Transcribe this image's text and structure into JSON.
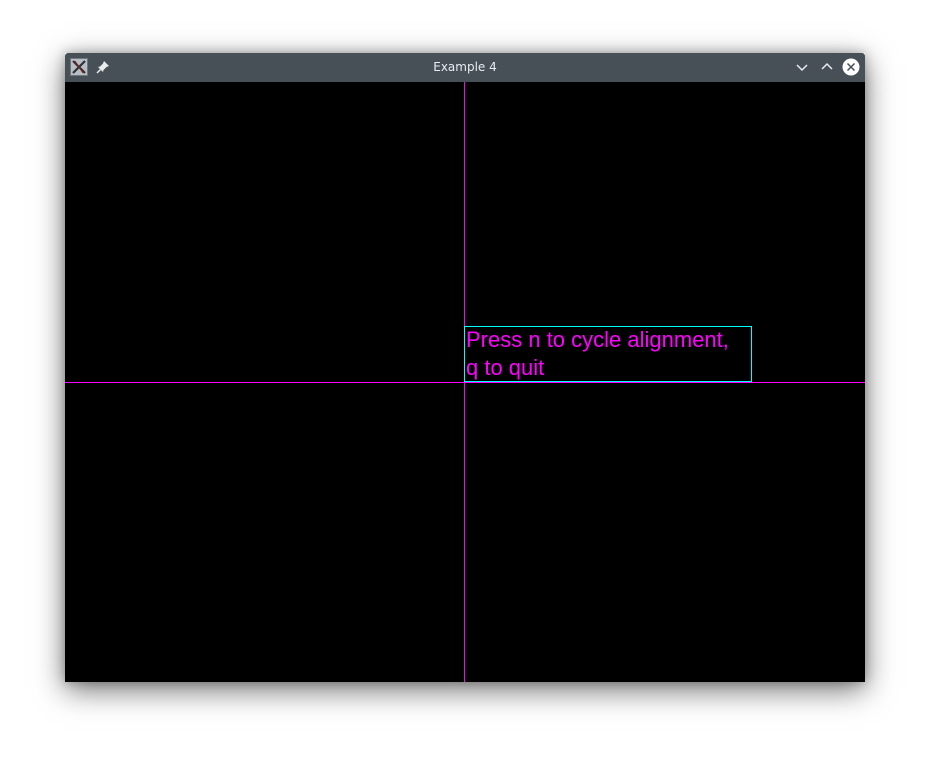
{
  "window": {
    "title": "Example 4"
  },
  "titlebar": {
    "icons": {
      "app": "x-window-icon",
      "pin": "pin-icon",
      "minimize": "chevron-down-icon",
      "maximize": "chevron-up-icon",
      "close": "close-icon"
    }
  },
  "canvas": {
    "text_lines": [
      "Press n to cycle alignment,",
      "q to quit"
    ]
  },
  "colors": {
    "background": "#000000",
    "text": "#ff00ff",
    "guide_lines": "#ff00ff",
    "bounding_box": "#00ffff",
    "titlebar": "#475057"
  }
}
